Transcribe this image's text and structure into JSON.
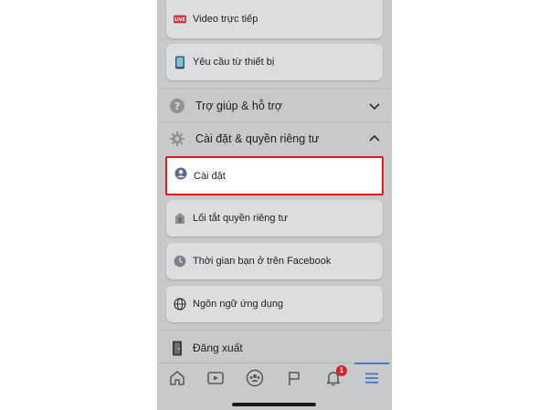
{
  "menu": {
    "items_top": [
      {
        "label": "Video trực tiếp",
        "icon": "live-video-icon"
      },
      {
        "label": "Yêu cầu từ thiết bị",
        "icon": "device-request-icon"
      }
    ],
    "help_section": {
      "label": "Trợ giúp & hỗ trợ",
      "icon": "help-icon",
      "expanded": false
    },
    "settings_section": {
      "label": "Cài đặt & quyền riêng tư",
      "icon": "gear-icon",
      "expanded": true
    },
    "settings_items": [
      {
        "label": "Cài đặt",
        "icon": "account-settings-icon",
        "highlighted": true
      },
      {
        "label": "Lối tắt quyền riêng tư",
        "icon": "privacy-shortcuts-icon"
      },
      {
        "label": "Thời gian bạn ở trên Facebook",
        "icon": "time-clock-icon"
      },
      {
        "label": "Ngôn ngữ ứng dụng",
        "icon": "globe-icon"
      }
    ],
    "logout": {
      "label": "Đăng xuất",
      "icon": "logout-door-icon"
    }
  },
  "tabbar": {
    "tabs": [
      {
        "name": "home",
        "icon": "home-icon"
      },
      {
        "name": "watch",
        "icon": "video-play-icon"
      },
      {
        "name": "groups",
        "icon": "groups-icon"
      },
      {
        "name": "pages",
        "icon": "flag-icon"
      },
      {
        "name": "notifications",
        "icon": "bell-icon",
        "badge": "1"
      },
      {
        "name": "menu",
        "icon": "hamburger-menu-icon",
        "active": true
      }
    ]
  },
  "colors": {
    "highlight_border": "#e31c1c",
    "badge": "#d8232a",
    "active_tab": "#4a78c2",
    "overlay_bg": "#c7c9cc"
  }
}
